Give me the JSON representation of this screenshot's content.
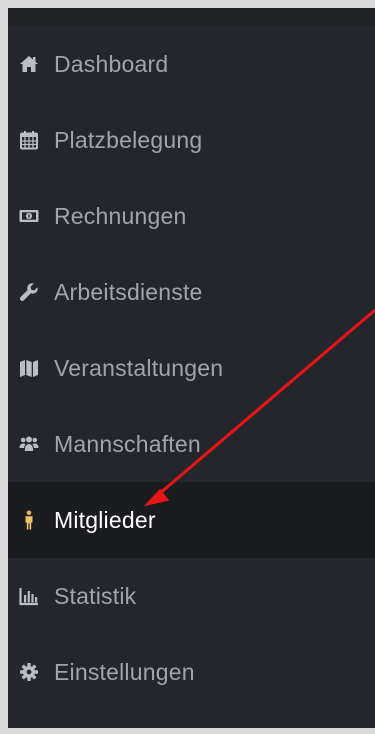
{
  "sidebar": {
    "active_index": 6,
    "items": [
      {
        "label": "Dashboard",
        "icon": "home-icon"
      },
      {
        "label": "Platzbelegung",
        "icon": "calendar-icon"
      },
      {
        "label": "Rechnungen",
        "icon": "money-bill-icon"
      },
      {
        "label": "Arbeitsdienste",
        "icon": "wrench-icon"
      },
      {
        "label": "Veranstaltungen",
        "icon": "map-icon"
      },
      {
        "label": "Mannschaften",
        "icon": "users-icon"
      },
      {
        "label": "Mitglieder",
        "icon": "person-icon"
      },
      {
        "label": "Statistik",
        "icon": "bar-chart-icon"
      },
      {
        "label": "Einstellungen",
        "icon": "gear-icon"
      }
    ]
  },
  "annotation": {
    "color": "#e81416",
    "target": "Mitglieder"
  },
  "colors": {
    "sidebar_bg": "#24262b",
    "active_bg": "#1b1c20",
    "text": "#a0a5ad",
    "active_text": "#ffffff"
  }
}
